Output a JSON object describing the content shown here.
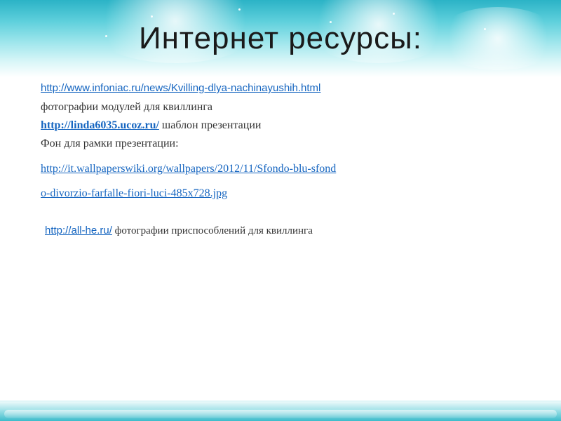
{
  "slide": {
    "title": "Интернет ресурсы:",
    "lines": {
      "l1_link": "http://www.infoniac.ru/news/Kvilling-dlya-nachinayushih.html",
      "l2_text": "фотографии  модулей для квиллинга",
      "l3_link": "http://linda6035.ucoz.ru/",
      "l3_text": " шаблон презентации",
      "l4_text": "Фон для рамки презентации:",
      "l5_link": "http://it.wallpaperswiki.org/wallpapers/2012/11/Sfondo-blu-sfond",
      "l6_link": "o-divorzio-farfalle-fiori-luci-485x728.jpg",
      "l7_link": "http://all-he.ru/",
      "l7_text": " фотографии приспособлений для квиллинга"
    }
  },
  "colors": {
    "link": "#1565c0",
    "header_top": "#2bb3c6",
    "footer": "#3dbccb"
  }
}
